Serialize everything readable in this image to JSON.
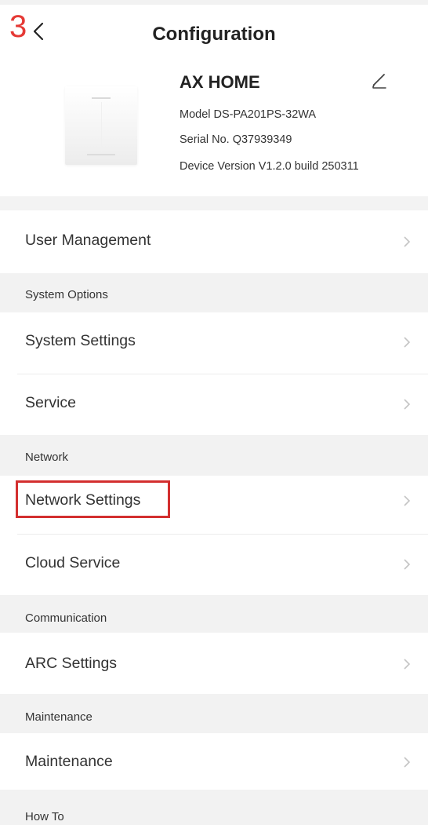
{
  "annotation": {
    "step_number": "3",
    "highlight_color": "#d32f2f"
  },
  "header": {
    "title": "Configuration",
    "back_icon": "chevron-left-icon"
  },
  "device": {
    "name": "AX HOME",
    "model": "Model DS-PA201PS-32WA",
    "serial": "Serial No. Q37939349",
    "version": "Device Version V1.2.0 build 250311",
    "edit_icon": "pencil-icon"
  },
  "menu": {
    "user_management": "User Management",
    "system_options_header": "System Options",
    "system_settings": "System Settings",
    "service": "Service",
    "network_header": "Network",
    "network_settings": "Network Settings",
    "cloud_service": "Cloud Service",
    "communication_header": "Communication",
    "arc_settings": "ARC Settings",
    "maintenance_header": "Maintenance",
    "maintenance": "Maintenance",
    "how_to_header": "How To"
  },
  "colors": {
    "section_bg": "#f2f2f2",
    "chevron": "#c4c4c4",
    "step_number": "#e53935"
  }
}
